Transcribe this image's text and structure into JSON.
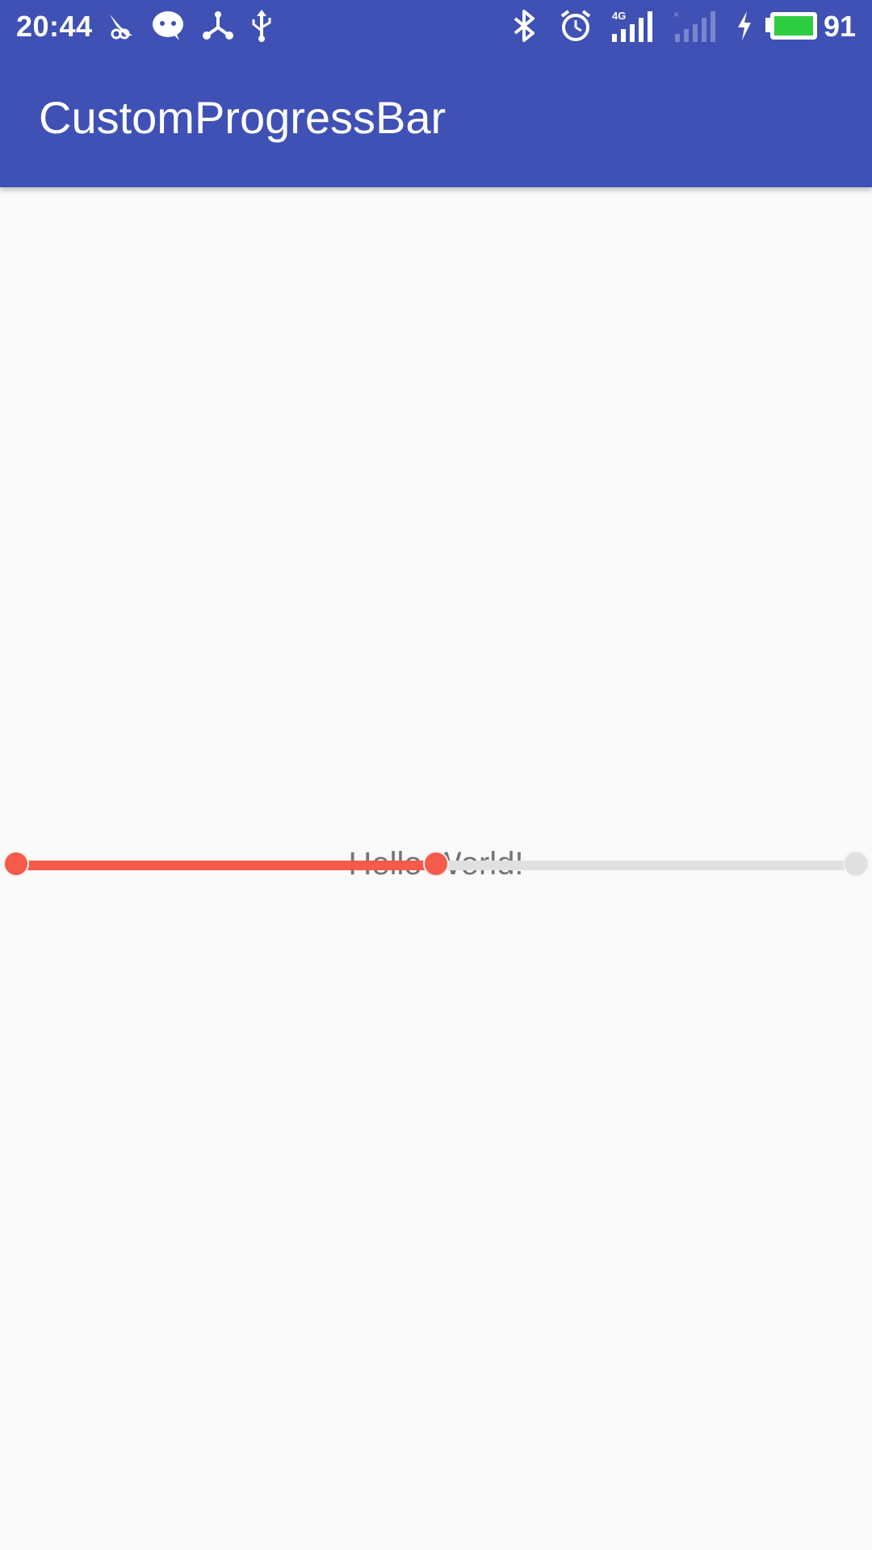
{
  "status_bar": {
    "time": "20:44",
    "network_label": "4G",
    "battery_percent": "91",
    "icons": [
      "notification-app-icon",
      "wechat-icon",
      "share-network-icon",
      "usb-icon",
      "bluetooth-icon",
      "alarm-icon",
      "signal-4g-icon",
      "signal-empty-icon",
      "charging-bolt-icon",
      "battery-icon"
    ]
  },
  "app_bar": {
    "title": "CustomProgressBar"
  },
  "main": {
    "hello_text": "Hello World!"
  },
  "progress_bar": {
    "progress": 0.5,
    "fill_color": "#f55a4a",
    "track_color": "#e0e0e0"
  },
  "colors": {
    "primary": "#3f51b5",
    "background": "#fafafa",
    "battery_fill": "#2ecc40"
  }
}
